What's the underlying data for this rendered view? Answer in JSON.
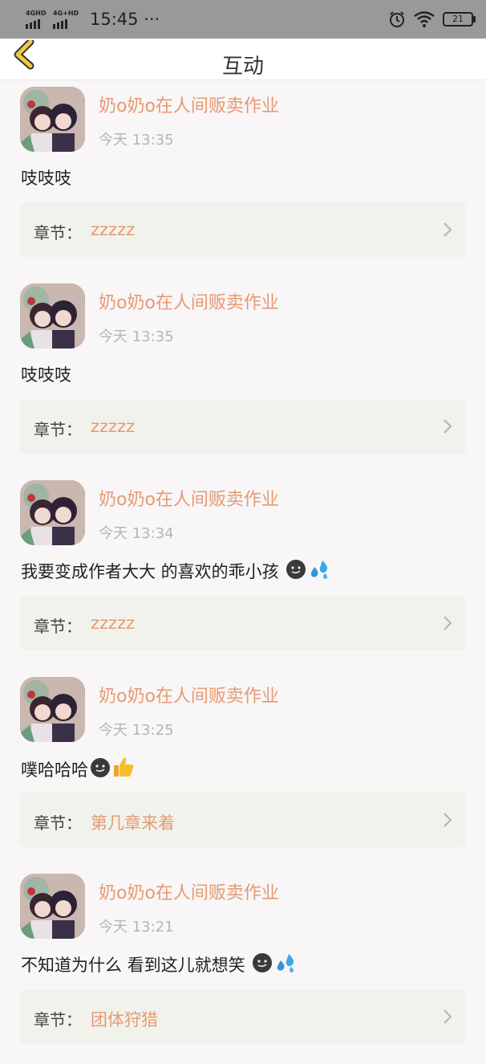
{
  "status_bar": {
    "network_1": "4GHD",
    "network_2": "4G+HD",
    "time": "15:45 ···",
    "battery": "21",
    "icons": [
      "alarm-icon",
      "wifi-icon",
      "battery-icon"
    ]
  },
  "nav": {
    "title": "互动",
    "back_icon": "back-chevron-icon"
  },
  "colors": {
    "accent": "#e69a73",
    "back_icon": "#f0cb3c",
    "chapter_bg": "#f2f2ec",
    "status_bar": "#999999",
    "page_bg": "#f8f6f7"
  },
  "items": [
    {
      "name": "奶o奶o在人间贩卖作业",
      "time": "今天 13:35",
      "comment": "吱吱吱",
      "emojis": [],
      "chapter_label": "章节：",
      "chapter_value": "zzzzz"
    },
    {
      "name": "奶o奶o在人间贩卖作业",
      "time": "今天 13:35",
      "comment": "吱吱吱",
      "emojis": [],
      "chapter_label": "章节：",
      "chapter_value": "zzzzz"
    },
    {
      "name": "奶o奶o在人间贩卖作业",
      "time": "今天 13:34",
      "comment": "我要变成作者大大 的喜欢的乖小孩 ",
      "emojis": [
        "smirk-face",
        "sweat-droplets"
      ],
      "chapter_label": "章节：",
      "chapter_value": "zzzzz"
    },
    {
      "name": "奶o奶o在人间贩卖作业",
      "time": "今天 13:25",
      "comment": "噗哈哈哈",
      "emojis": [
        "smirk-face",
        "thumbs-up"
      ],
      "chapter_label": "章节：",
      "chapter_value": "第几章来着"
    },
    {
      "name": "奶o奶o在人间贩卖作业",
      "time": "今天 13:21",
      "comment": "不知道为什么 看到这儿就想笑 ",
      "emojis": [
        "smirk-face",
        "sweat-droplets"
      ],
      "chapter_label": "章节：",
      "chapter_value": "团体狩猎"
    }
  ]
}
